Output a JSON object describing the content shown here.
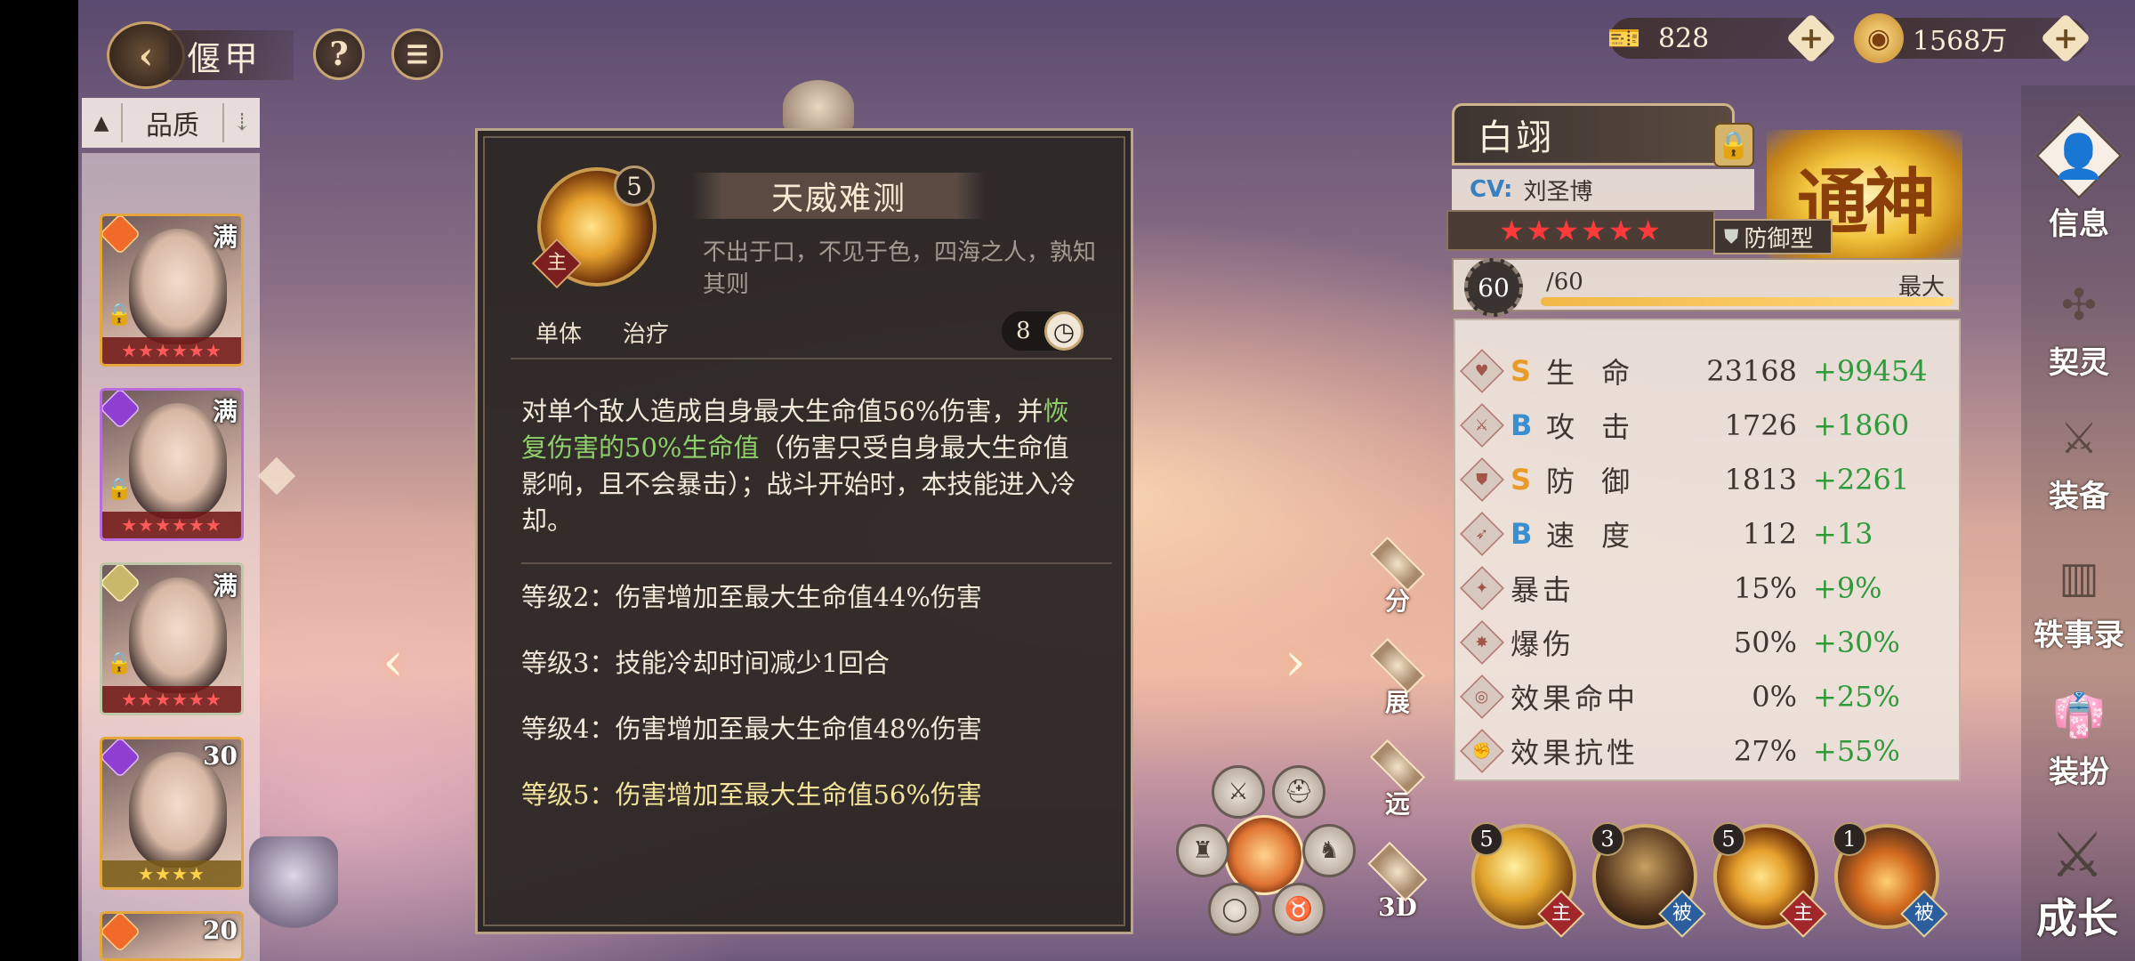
{
  "header": {
    "back_icon": "back-arrow-icon",
    "title": "偃甲",
    "help_label": "?",
    "chat_icon": "chat-icon"
  },
  "sort": {
    "arrow": "▲",
    "label": "品质",
    "filter_icon": "sort-icon"
  },
  "hero_list": [
    {
      "level": "满",
      "stars": "★★★★★★",
      "frame": "orange",
      "locked": true
    },
    {
      "level": "满",
      "stars": "★★★★★★",
      "frame": "purple",
      "locked": true
    },
    {
      "level": "满",
      "stars": "★★★★★★",
      "frame": "silver",
      "locked": true
    },
    {
      "level": "30",
      "stars": "★★★★",
      "frame": "purple",
      "locked": false
    },
    {
      "level": "20",
      "stars": "",
      "frame": "orange",
      "locked": false
    }
  ],
  "skill": {
    "level": "5",
    "type_badge": "主",
    "name": "天威难测",
    "quote": "不出于口，不见于色，四海之人，孰知其则",
    "tags": [
      "单体",
      "治疗"
    ],
    "cooldown": "8",
    "desc_part1": "对单个敌人造成自身最大生命值56%伤害，并",
    "desc_highlight": "恢复伤害的50%生命值",
    "desc_part2": "（伤害只受自身最大生命值影响，且不会暴击）；战斗开始时，本技能进入冷却。",
    "levels": [
      "等级2：伤害增加至最大生命值44%伤害",
      "等级3：技能冷却时间减少1回合",
      "等级4：伤害增加至最大生命值48%伤害",
      "等级5：伤害增加至最大生命值56%伤害"
    ]
  },
  "side_buttons": {
    "split": "分",
    "expand": "展",
    "far": "远",
    "three_d": "3D"
  },
  "currency": [
    {
      "icon": "ticket-icon",
      "value": "828",
      "plus": "+"
    },
    {
      "icon": "coin-icon",
      "value": "1568万",
      "plus": "+"
    }
  ],
  "hero": {
    "name": "白翊",
    "cv_label": "CV:",
    "cv_name": "刘圣博",
    "stars": "★★★★★★",
    "type": "防御型",
    "rank": "通神",
    "level": "60",
    "level_max": "/60",
    "level_max_label": "最大",
    "level_progress": 1.0
  },
  "stats": [
    {
      "icon": "hp-icon",
      "grade": "S",
      "name": "生 命",
      "base": "23168",
      "bonus": "+99454"
    },
    {
      "icon": "attack-icon",
      "grade": "B",
      "name": "攻 击",
      "base": "1726",
      "bonus": "+1860"
    },
    {
      "icon": "defense-icon",
      "grade": "S",
      "name": "防 御",
      "base": "1813",
      "bonus": "+2261"
    },
    {
      "icon": "speed-icon",
      "grade": "B",
      "name": "速 度",
      "base": "112",
      "bonus": "+13"
    },
    {
      "icon": "crit-icon",
      "grade": "",
      "name": "暴击",
      "base": "15%",
      "bonus": "+9%"
    },
    {
      "icon": "crit-dmg-icon",
      "grade": "",
      "name": "爆伤",
      "base": "50%",
      "bonus": "+30%"
    },
    {
      "icon": "hit-icon",
      "grade": "",
      "name": "效果命中",
      "base": "0%",
      "bonus": "+25%"
    },
    {
      "icon": "resist-icon",
      "grade": "",
      "name": "效果抗性",
      "base": "27%",
      "bonus": "+55%"
    }
  ],
  "skill_icons": [
    {
      "num": "5",
      "type": "主"
    },
    {
      "num": "3",
      "type": "被"
    },
    {
      "num": "5",
      "type": "主"
    },
    {
      "num": "1",
      "type": "被"
    }
  ],
  "right_menu": [
    {
      "label": "信息",
      "icon": "person-icon"
    },
    {
      "label": "契灵",
      "icon": "spirit-icon"
    },
    {
      "label": "装备",
      "icon": "equipment-icon"
    },
    {
      "label": "轶事录",
      "icon": "book-icon"
    },
    {
      "label": "装扮",
      "icon": "outfit-icon"
    }
  ],
  "grow_label": "成长",
  "colors": {
    "stat_bonus": "#2e9a3a",
    "grade_S": "#e89a2a",
    "grade_B": "#3a8fd0",
    "skill_highlight": "#8ed06a",
    "skill_level5": "#f3e39a"
  }
}
